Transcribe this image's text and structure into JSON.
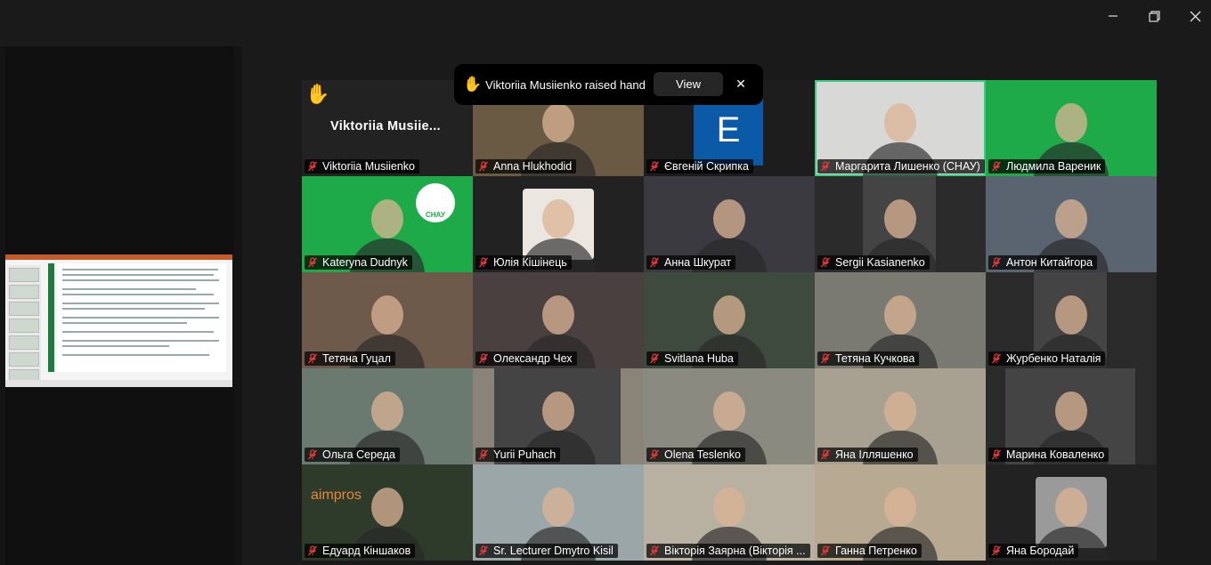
{
  "window": {
    "minimize_icon": "minimize-icon",
    "restore_icon": "restore-icon",
    "close_icon": "close-icon"
  },
  "toast": {
    "hand": "✋",
    "message": "Viktoriia Musiienko raised hand",
    "view_label": "View",
    "close_glyph": "✕"
  },
  "self_tile": {
    "hand": "✋",
    "display_name": "Viktoriia  Musiie..."
  },
  "participants": [
    {
      "name": "Viktoriia Musiienko"
    },
    {
      "name": "Anna Hlukhodid"
    },
    {
      "name": "Євгеній Скрипка",
      "avatar_letter": "E"
    },
    {
      "name": "Маргарита Лишенко (СНАУ)"
    },
    {
      "name": "Людмила Вареник"
    },
    {
      "name": "Kateryna Dudnyk",
      "logo_text": "СНАУ"
    },
    {
      "name": "Юлія Кішінець"
    },
    {
      "name": "Анна Шкурат"
    },
    {
      "name": "Sergii Kasianenko"
    },
    {
      "name": "Антон Китайгора"
    },
    {
      "name": "Тетяна Гуцал"
    },
    {
      "name": "Олександр Чех"
    },
    {
      "name": "Svitlana Huba"
    },
    {
      "name": "Тетяна Кучкова"
    },
    {
      "name": "Журбенко Наталія"
    },
    {
      "name": "Ольга Середа"
    },
    {
      "name": "Yurii Puhach"
    },
    {
      "name": "Olena Teslenko"
    },
    {
      "name": "Яна Ілляшенко"
    },
    {
      "name": "Марина Коваленко"
    },
    {
      "name": "Едуард Кіншаков",
      "bg_text": "aimpros"
    },
    {
      "name": "Sr. Lecturer Dmytro Kisil"
    },
    {
      "name": "Вікторія Заярна (Вікторія ..."
    },
    {
      "name": "Ганна Петренко"
    },
    {
      "name": "Яна Бородай"
    }
  ],
  "colors": {
    "speaker_highlight": "#30d07c",
    "background": "#1a1a1a",
    "muted_mic": "#e03a3a",
    "green_bg": "#1faa4a"
  }
}
